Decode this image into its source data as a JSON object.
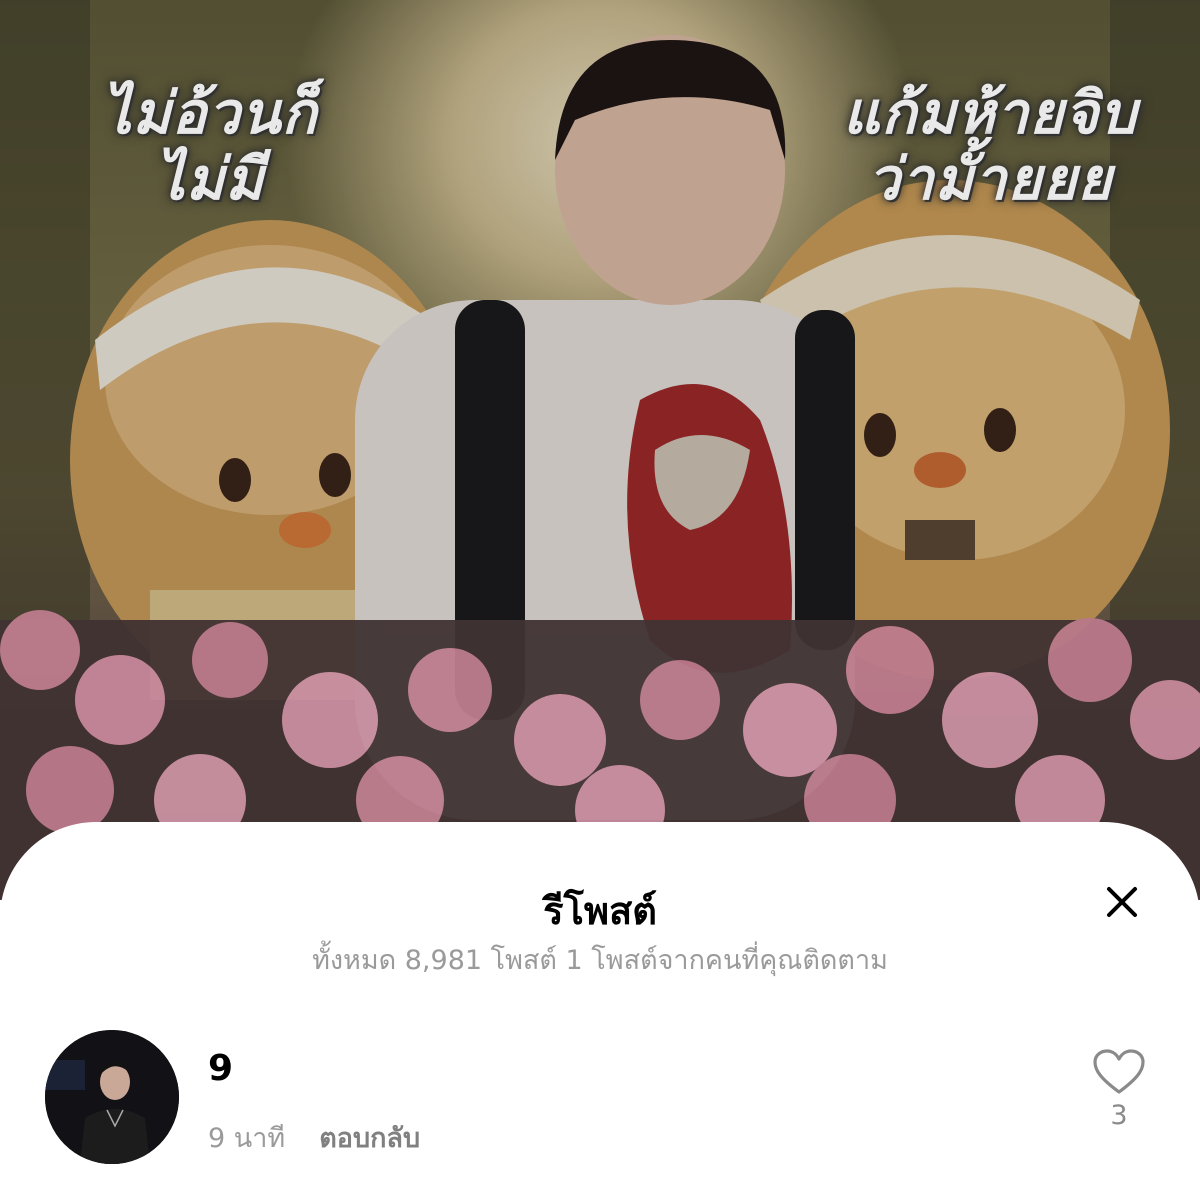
{
  "post_image": {
    "overlay_left": "ไม่อ้วนก็\nไม่มี",
    "overlay_right": "แก้มห้ายจิบ\nว่ามั้ายยย"
  },
  "sheet": {
    "title": "รีโพสต์",
    "subtitle": "ทั้งหมด 8,981 โพสต์ 1 โพสต์จากคนที่คุณติดตาม",
    "close_icon": "close-icon"
  },
  "reply": {
    "username": "9",
    "time": "9 นาที",
    "reply_label": "ตอบกลับ",
    "like_count": "3",
    "like_icon": "heart-outline-icon"
  },
  "colors": {
    "sheet_bg": "#ffffff",
    "muted_text": "#9a9a9a",
    "primary_text": "#000000"
  }
}
